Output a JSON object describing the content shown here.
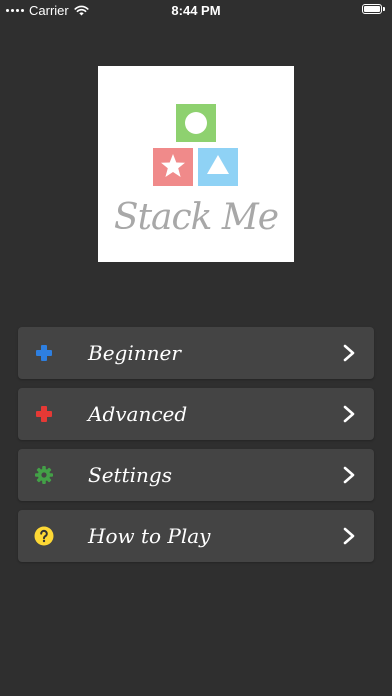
{
  "status_bar": {
    "carrier": "Carrier",
    "time": "8:44 PM"
  },
  "logo": {
    "text": "Stack Me"
  },
  "menu": {
    "items": [
      {
        "label": "Beginner",
        "icon": "gamepad-icon",
        "icon_color": "#2e7fe0"
      },
      {
        "label": "Advanced",
        "icon": "gamepad-icon",
        "icon_color": "#e53935"
      },
      {
        "label": "Settings",
        "icon": "gear-icon",
        "icon_color": "#43a047"
      },
      {
        "label": "How to Play",
        "icon": "question-icon",
        "icon_color": "#fdd835"
      }
    ]
  },
  "colors": {
    "background": "#2f2f2f",
    "card": "#444444",
    "block_green": "#8ed16f",
    "block_red": "#f08a8a",
    "block_blue": "#8fd2f5"
  }
}
